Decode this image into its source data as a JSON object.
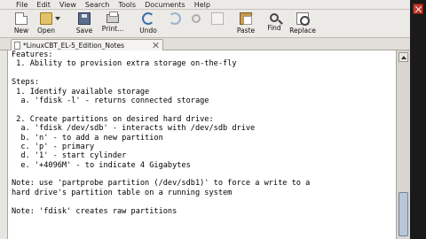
{
  "menu": {
    "items": [
      "File",
      "Edit",
      "View",
      "Search",
      "Tools",
      "Documents",
      "Help"
    ]
  },
  "toolbar": {
    "new_label": "New",
    "open_label": "Open",
    "save_label": "Save",
    "print_label": "Print...",
    "undo_label": "Undo",
    "paste_label": "Paste",
    "find_label": "Find",
    "replace_label": "Replace"
  },
  "tab": {
    "title": "*LinuxCBT_EL-5_Edition_Notes"
  },
  "editor": {
    "lines": [
      "Features:",
      " 1. Ability to provision extra storage on-the-fly",
      "",
      "Steps:",
      " 1. Identify available storage",
      "  a. 'fdisk -l' - returns connected storage",
      "",
      " 2. Create partitions on desired hard drive:",
      "  a. 'fdisk /dev/sdb' - interacts with /dev/sdb drive",
      "  b. 'n' - to add a new partition",
      "  c. 'p' - primary",
      "  d. '1' - start cylinder",
      "  e. '+4096M' - to indicate 4 Gigabytes",
      "",
      "Note: use 'partprobe partition (/dev/sdb1)' to force a write to a",
      "hard drive's partition table on a running system",
      "",
      "Note: 'fdisk' creates raw partitions",
      "",
      ""
    ]
  }
}
